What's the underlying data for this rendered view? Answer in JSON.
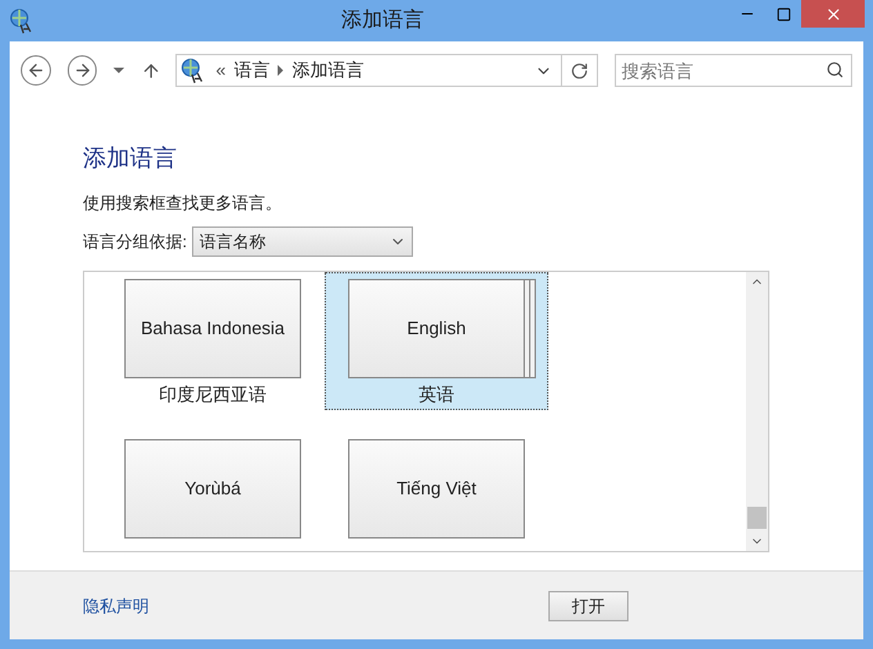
{
  "window": {
    "title": "添加语言"
  },
  "address": {
    "crumbs": [
      "语言",
      "添加语言"
    ],
    "separator": "«"
  },
  "search": {
    "placeholder": "搜索语言"
  },
  "heading": "添加语言",
  "hint": "使用搜索框查找更多语言。",
  "group_by": {
    "label": "语言分组依据:",
    "value": "语言名称"
  },
  "tiles": [
    {
      "name": "Bahasa Indonesia",
      "label": "印度尼西亚语",
      "selected": false,
      "stacked": false
    },
    {
      "name": "English",
      "label": "英语",
      "selected": true,
      "stacked": true
    },
    {
      "name": "Yorùbá",
      "selected": false,
      "stacked": false
    },
    {
      "name": "Tiếng Việt",
      "selected": false,
      "stacked": false
    }
  ],
  "privacy_link": "隐私声明",
  "buttons": [
    "打开"
  ]
}
